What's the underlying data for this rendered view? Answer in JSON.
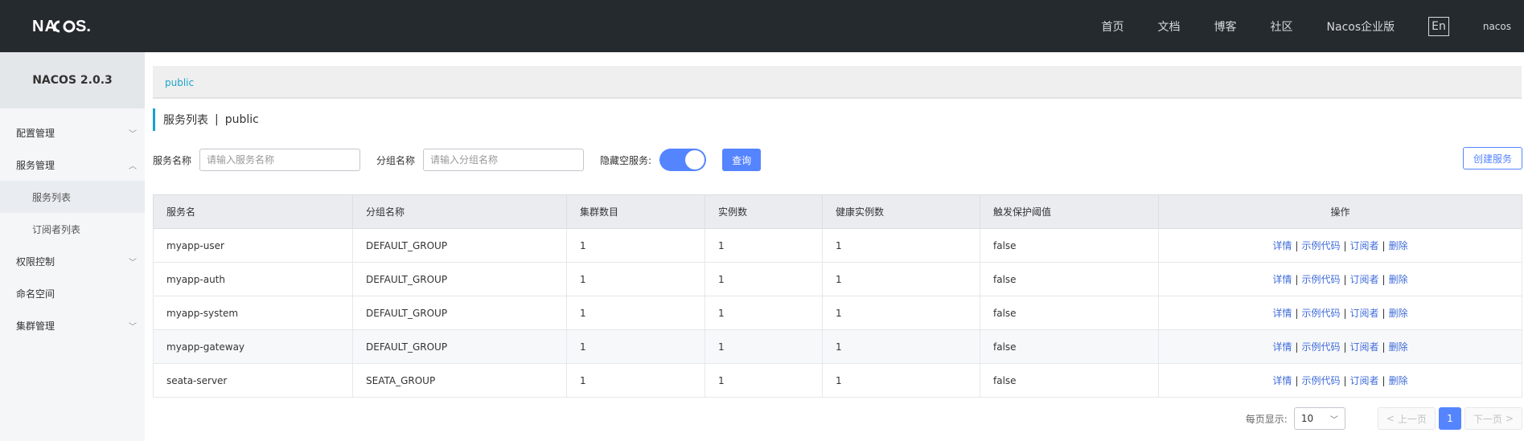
{
  "header": {
    "logo_text": "NACOS.",
    "nav": [
      "首页",
      "文档",
      "博客",
      "社区",
      "Nacos企业版"
    ],
    "lang": "En",
    "user": "nacos"
  },
  "sidebar": {
    "version": "NACOS 2.0.3",
    "items": [
      {
        "label": "配置管理",
        "icon": "chevron-down-icon"
      },
      {
        "label": "服务管理",
        "icon": "chevron-up-icon"
      },
      {
        "label": "服务列表"
      },
      {
        "label": "订阅者列表"
      },
      {
        "label": "权限控制",
        "icon": "chevron-down-icon"
      },
      {
        "label": "命名空间"
      },
      {
        "label": "集群管理",
        "icon": "chevron-down-icon"
      }
    ]
  },
  "main": {
    "breadcrumb": "public",
    "title": "服务列表",
    "title_sep": "|",
    "namespace": "public",
    "filter": {
      "service_label": "服务名称",
      "service_placeholder": "请输入服务名称",
      "group_label": "分组名称",
      "group_placeholder": "请输入分组名称",
      "hide_empty_label": "隐藏空服务:",
      "query_button": "查询",
      "create_button": "创建服务"
    },
    "table": {
      "headers": [
        "服务名",
        "分组名称",
        "集群数目",
        "实例数",
        "健康实例数",
        "触发保护阈值",
        "操作"
      ],
      "rows": [
        [
          "myapp-user",
          "DEFAULT_GROUP",
          "1",
          "1",
          "1",
          "false"
        ],
        [
          "myapp-auth",
          "DEFAULT_GROUP",
          "1",
          "1",
          "1",
          "false"
        ],
        [
          "myapp-system",
          "DEFAULT_GROUP",
          "1",
          "1",
          "1",
          "false"
        ],
        [
          "myapp-gateway",
          "DEFAULT_GROUP",
          "1",
          "1",
          "1",
          "false"
        ],
        [
          "seata-server",
          "SEATA_GROUP",
          "1",
          "1",
          "1",
          "false"
        ]
      ],
      "actions": [
        "详情",
        "示例代码",
        "订阅者",
        "删除"
      ],
      "action_sep": "|"
    },
    "pagination": {
      "page_size_label": "每页显示:",
      "page_size": "10",
      "prev": "上一页",
      "current": "1",
      "next": "下一页"
    }
  },
  "colors": {
    "header_bg": "#252a2f",
    "primary": "#5584ff",
    "link": "#3f6bd9"
  }
}
